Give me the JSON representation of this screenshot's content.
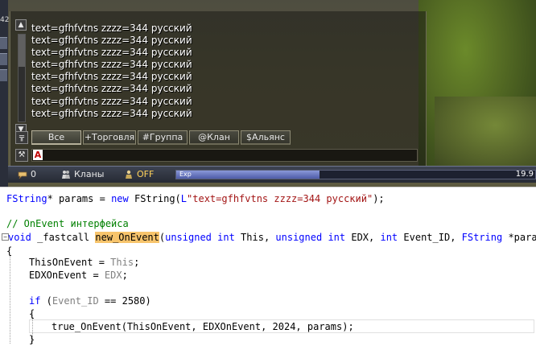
{
  "left_strip": {
    "number": "42"
  },
  "chat": {
    "lines": [
      "text=gfhfvtns zzzz=344 русский",
      "text=gfhfvtns zzzz=344 русский",
      "text=gfhfvtns zzzz=344 русский",
      "text=gfhfvtns zzzz=344 русский",
      "text=gfhfvtns zzzz=344 русский",
      "text=gfhfvtns zzzz=344 русский",
      "text=gfhfvtns zzzz=344 русский",
      "text=gfhfvtns zzzz=344 русский"
    ],
    "tabs": [
      "Все",
      "+Торговля",
      "#Группа",
      "@Клан",
      "$Альянс"
    ],
    "active_tab": "Все",
    "input_value": "",
    "red_a_label": "A"
  },
  "status_bar": {
    "count": "0",
    "clans_label": "Кланы",
    "off_label": "OFF",
    "exp_label": "Exp",
    "exp_fraction": 0.4,
    "exp_value": "19.9",
    "off_color": "#ffd25a"
  },
  "code": {
    "line_params": {
      "type": "FString",
      "var": "* params = ",
      "kw_new": "new",
      "ctor": " FString(",
      "prefix": "L",
      "literal": "\"text=gfhfvtns zzzz=344 русский\"",
      "end": ");"
    },
    "comment": "// OnEvent интерфейса",
    "sig": {
      "kw_void": "void",
      "fastcall": " _fastcall ",
      "fn": "new_OnEvent",
      "open": "(",
      "kw_unsigned1": "unsigned",
      "kw_int1": "int",
      "p1": " This, ",
      "kw_unsigned2": "unsigned",
      "kw_int2": "int",
      "p2": " EDX, ",
      "kw_int3": "int",
      "p3": " Event_ID, ",
      "type4": "FString",
      "p4": " *param)"
    },
    "brace_open": "{",
    "assign1_lhs": "ThisOnEvent = ",
    "assign1_rhs": "This",
    "assign1_end": ";",
    "assign2_lhs": "EDXOnEvent = ",
    "assign2_rhs": "EDX",
    "assign2_end": ";",
    "if_kw": "if",
    "if_open": " (",
    "if_var": "Event_ID",
    "if_rest": " == 2580)",
    "inner_brace": "{",
    "call": "true_OnEvent(ThisOnEvent, EDXOnEvent, 2024, params);",
    "inner_close": "}",
    "outline_sign": "−"
  },
  "colors": {
    "keyword": "#0000ff",
    "string": "#a31515",
    "comment": "#008000",
    "highlight": "#f7c46c",
    "exp_bar": "#6f7fcf"
  }
}
